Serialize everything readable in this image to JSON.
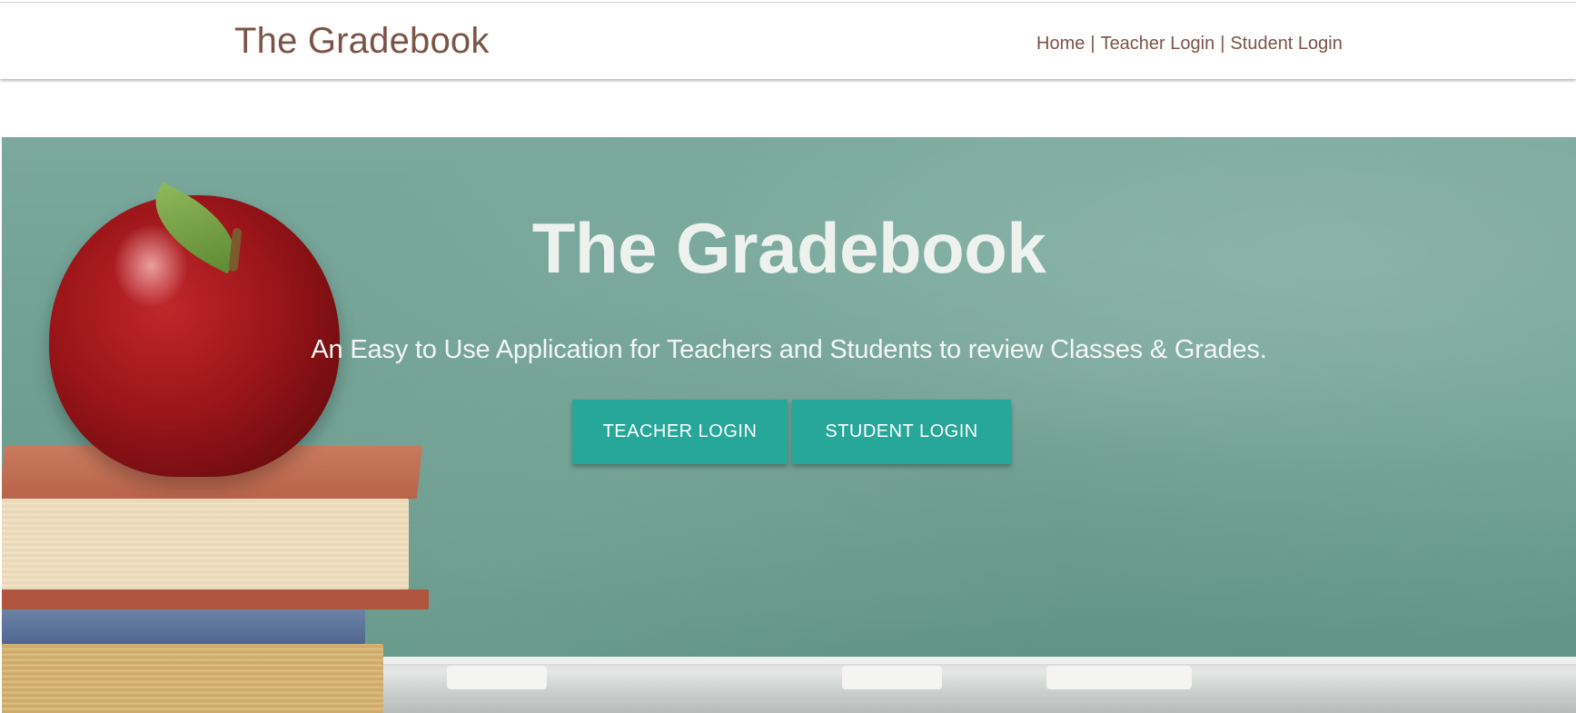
{
  "navbar": {
    "brand": "The Gradebook",
    "links": [
      {
        "label": "Home"
      },
      {
        "label": "Teacher Login"
      },
      {
        "label": "Student Login"
      }
    ],
    "separator": "|"
  },
  "hero": {
    "title": "The Gradebook",
    "subtitle": "An Easy to Use Application for Teachers and Students to review Classes & Grades.",
    "buttons": {
      "teacher": "TEACHER LOGIN",
      "student": "STUDENT LOGIN"
    },
    "background_description_icons": [
      "apple-image",
      "books-image",
      "chalkboard-image"
    ]
  },
  "colors": {
    "brand_text": "#7a5446",
    "button": "#27a69a",
    "chalkboard": "#6f9f92"
  }
}
